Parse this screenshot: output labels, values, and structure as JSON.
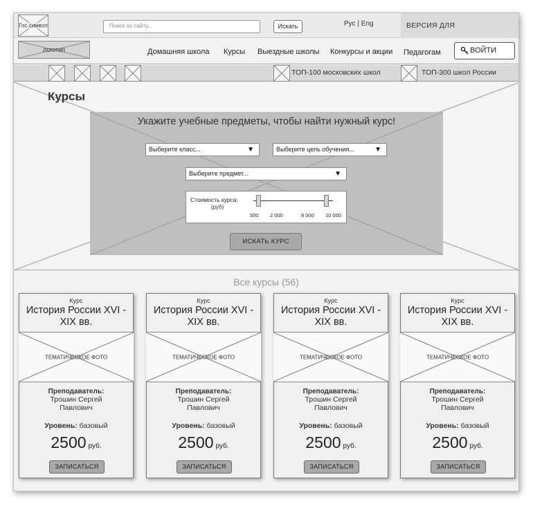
{
  "topbar": {
    "gov_symbol": "Гос.символ",
    "search_placeholder": "Поиск по сайту...",
    "search_button": "Искать",
    "lang_ru": "Рус",
    "lang_sep": "|",
    "lang_en": "Eng",
    "vision_version": "ВЕРСИЯ ДЛЯ СЛАБОВИДЯЩИХ"
  },
  "navbar": {
    "logo": "логотип",
    "items": [
      "Домашняя школа",
      "Курсы",
      "Выездные школы",
      "Конкурсы и акции",
      "Педагогам"
    ],
    "login": "ВОЙТИ"
  },
  "strip": {
    "top100": "ТОП-100 московских школ",
    "top300": "ТОП-300 школ России"
  },
  "hero": {
    "title": "Курсы",
    "filter_title": "Укажите учебные предметы, чтобы найти нужный курс!",
    "select_grade": "Выберите класс...",
    "select_goal": "Выберите цель обучения...",
    "select_subject": "Выберите предмет...",
    "price_label": "Стоимость курса:",
    "price_unit": "(руб)",
    "price_ticks": [
      "500",
      "2 000",
      "8 000",
      "10 000"
    ],
    "price_range": {
      "min": 500,
      "max": 10000
    },
    "search_course_button": "ИСКАТЬ КУРС"
  },
  "courses": {
    "heading": "Все курсы (56)",
    "items": [
      {
        "kind": "Курс",
        "name": "История России XVI - XIX вв.",
        "photo": "ТЕМАТИЧЕСКОЕ ФОТО",
        "teacher_label": "Преподаватель:",
        "teacher": "Трошин Сергей Павлович",
        "level_label": "Уровень:",
        "level": "базовый",
        "price": "2500",
        "currency": "руб.",
        "enroll": "ЗАПИСАТЬСЯ"
      },
      {
        "kind": "Курс",
        "name": "История России XVI - XIX вв.",
        "photo": "ТЕМАТИЧЕСКОЕ ФОТО",
        "teacher_label": "Преподаватель:",
        "teacher": "Трошин Сергей Павлович",
        "level_label": "Уровень:",
        "level": "базовый",
        "price": "2500",
        "currency": "руб.",
        "enroll": "ЗАПИСАТЬСЯ"
      },
      {
        "kind": "Курс",
        "name": "История России XVI - XIX вв.",
        "photo": "ТЕМАТИЧЕСКОЕ ФОТО",
        "teacher_label": "Преподаватель:",
        "teacher": "Трошин Сергей Павлович",
        "level_label": "Уровень:",
        "level": "базовый",
        "price": "2500",
        "currency": "руб.",
        "enroll": "ЗАПИСАТЬСЯ"
      },
      {
        "kind": "Курс",
        "name": "История России XVI - XIX вв.",
        "photo": "ТЕМАТИЧЕСКОЕ ФОТО",
        "teacher_label": "Преподаватель:",
        "teacher": "Трошин Сергей Павлович",
        "level_label": "Уровень:",
        "level": "базовый",
        "price": "2500",
        "currency": "руб.",
        "enroll": "ЗАПИСАТЬСЯ"
      }
    ]
  },
  "colors": {
    "frame_bg": "#f2f2f2",
    "filter_bg": "#bfbfbf",
    "button_bg": "#a9a9a9"
  }
}
